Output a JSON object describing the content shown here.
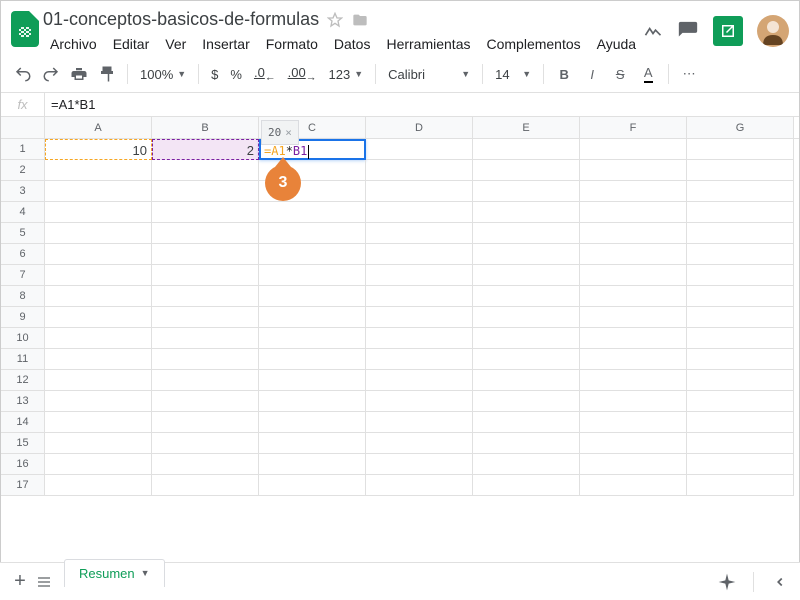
{
  "doc": {
    "title": "01-conceptos-basicos-de-formulas"
  },
  "menus": [
    "Archivo",
    "Editar",
    "Ver",
    "Insertar",
    "Formato",
    "Datos",
    "Herramientas",
    "Complementos",
    "Ayuda"
  ],
  "toolbar": {
    "zoom": "100%",
    "currency": "$",
    "percent": "%",
    "dec_dec": ".0",
    "dec_inc": ".00",
    "num_fmt": "123",
    "font": "Calibri",
    "size": "14"
  },
  "fx": {
    "label": "fx",
    "formula": "=A1*B1"
  },
  "columns": [
    "A",
    "B",
    "C",
    "D",
    "E",
    "F",
    "G"
  ],
  "rows": [
    1,
    2,
    3,
    4,
    5,
    6,
    7,
    8,
    9,
    10,
    11,
    12,
    13,
    14,
    15,
    16,
    17
  ],
  "cells": {
    "A1": "10",
    "B1": "2",
    "C1_a": "=A1",
    "C1_op": "*",
    "C1_b": "B1"
  },
  "tooltip": {
    "value": "20",
    "close": "×"
  },
  "callout": "3",
  "sheet": {
    "name": "Resumen"
  }
}
